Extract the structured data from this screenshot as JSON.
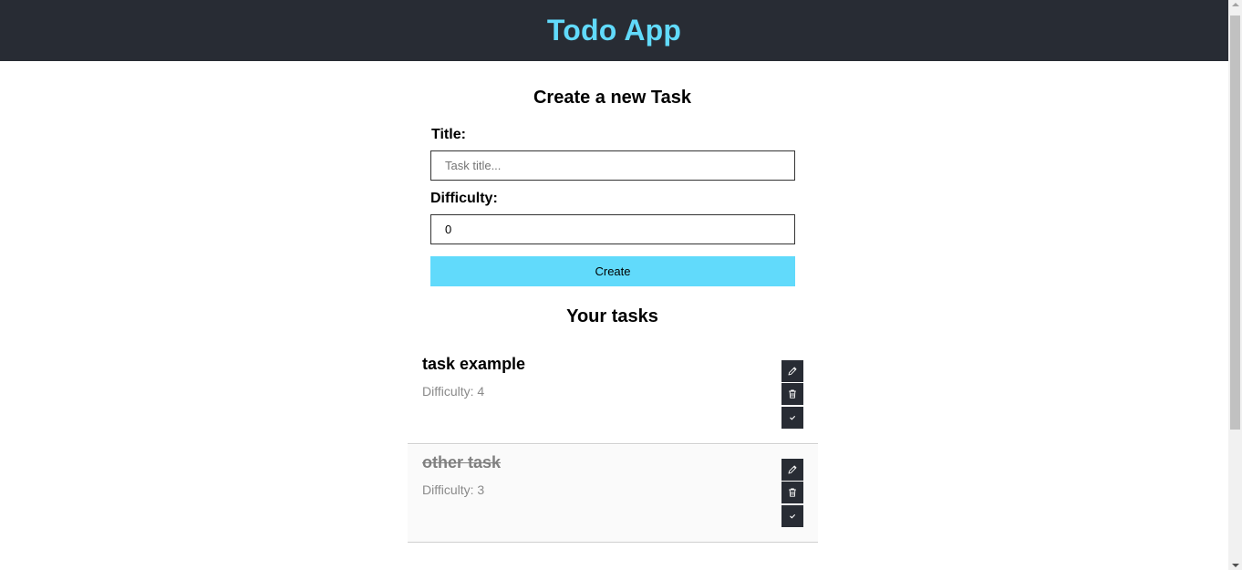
{
  "header": {
    "title": "Todo App"
  },
  "form": {
    "heading": "Create a new Task",
    "title_label": "Title:",
    "title_placeholder": "Task title...",
    "title_value": "",
    "difficulty_label": "Difficulty:",
    "difficulty_value": "0",
    "create_label": "Create"
  },
  "tasks_heading": "Your tasks",
  "tasks": [
    {
      "title": "task example",
      "difficulty": "Difficulty: 4",
      "completed": false
    },
    {
      "title": "other task",
      "difficulty": "Difficulty: 3",
      "completed": true
    }
  ],
  "icons": {
    "edit": "pencil-icon",
    "delete": "trash-icon",
    "complete": "check-icon"
  },
  "colors": {
    "header_bg": "#282c34",
    "accent": "#61dafb"
  }
}
